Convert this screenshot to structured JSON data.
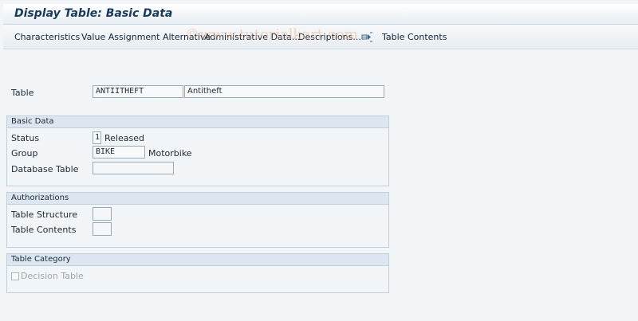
{
  "window": {
    "title": "Display Table: Basic Data"
  },
  "toolbar": {
    "items": [
      "Characteristics",
      "Value Assignment Alternative",
      "Administrative Data...",
      "Descriptions...",
      "Table Contents"
    ],
    "watermark": "©www.tutorialkart.com"
  },
  "table": {
    "label": "Table",
    "code": "ANTIITHEFT",
    "description": "Antitheft"
  },
  "basic_data": {
    "header": "Basic Data",
    "status_label": "Status",
    "status_value": "1",
    "status_text": "Released",
    "group_label": "Group",
    "group_value": "BIKE",
    "group_text": "Motorbike",
    "db_table_label": "Database Table",
    "db_table_value": ""
  },
  "authorizations": {
    "header": "Authorizations",
    "structure_label": "Table Structure",
    "structure_value": "",
    "contents_label": "Table Contents",
    "contents_value": ""
  },
  "table_category": {
    "header": "Table Category",
    "decision_label": "Decision Table",
    "decision_checked": false
  },
  "icons": {
    "descriptions_button": "multiple-selection-arrow-icon"
  }
}
